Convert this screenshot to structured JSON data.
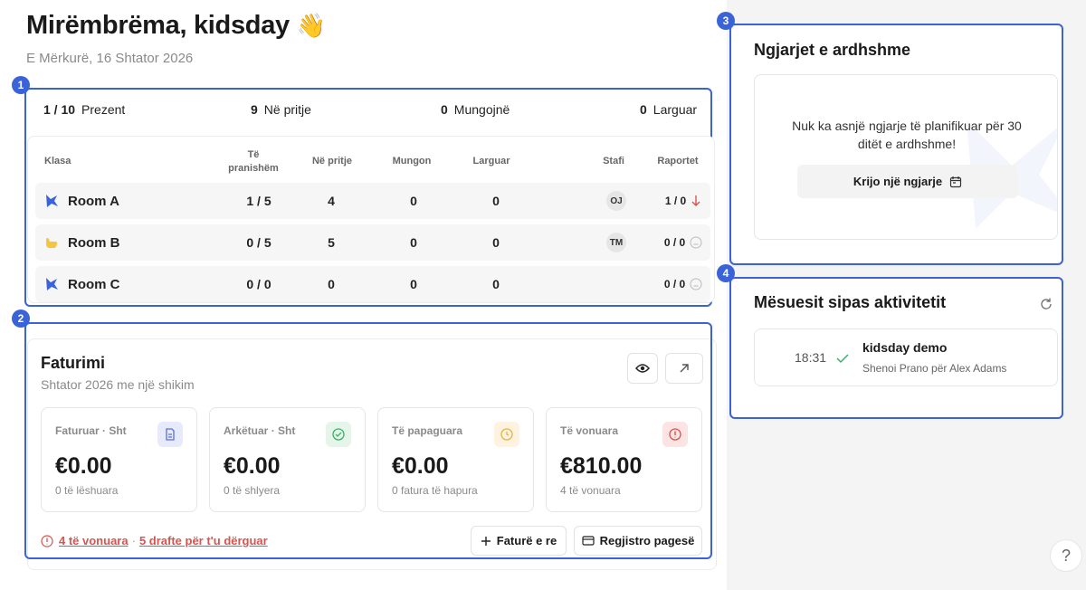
{
  "header": {
    "greeting": "Mirëmbrëma, kidsday",
    "wave_icon": "waving-hand",
    "date": "E Mërkurë, 16 Shtator 2026"
  },
  "annotations": [
    "1",
    "2",
    "3",
    "4"
  ],
  "attendance": {
    "stats": [
      {
        "value": "1 / 10",
        "label": "Prezent"
      },
      {
        "value": "9",
        "label": "Në pritje"
      },
      {
        "value": "0",
        "label": "Mungojnë"
      },
      {
        "value": "0",
        "label": "Larguar"
      }
    ],
    "columns": {
      "class": "Klasa",
      "present": "Të pranishëm",
      "pending": "Në pritje",
      "absent": "Mungon",
      "left": "Larguar",
      "staff": "Stafi",
      "reports": "Raportet"
    },
    "rows": [
      {
        "name": "Room A",
        "present": "1 / 5",
        "pending": "4",
        "absent": "0",
        "left": "0",
        "staff": "OJ",
        "reports": "1 / 0",
        "report_icon": "arrow-down",
        "icon_color": "#3b63d8"
      },
      {
        "name": "Room B",
        "present": "0 / 5",
        "pending": "5",
        "absent": "0",
        "left": "0",
        "staff": "TM",
        "reports": "0 / 0",
        "report_icon": "neutral-face",
        "icon_color": "#f5c542"
      },
      {
        "name": "Room C",
        "present": "0 / 0",
        "pending": "0",
        "absent": "0",
        "left": "0",
        "staff": "",
        "reports": "0 / 0",
        "report_icon": "neutral-face",
        "icon_color": "#3b63d8"
      }
    ]
  },
  "billing": {
    "title": "Faturimi",
    "subtitle": "Shtator 2026 me një shikim",
    "kpis": [
      {
        "label": "Faturuar · Sht",
        "value": "€0.00",
        "sub": "0 të lëshuara",
        "icon": "document-icon",
        "color": "#5b6fd6",
        "bg": "#e7eafb"
      },
      {
        "label": "Arkëtuar · Sht",
        "value": "€0.00",
        "sub": "0 të shlyera",
        "icon": "check-circle-icon",
        "color": "#3fae6a",
        "bg": "#e5f5ea"
      },
      {
        "label": "Të papaguara",
        "value": "€0.00",
        "sub": "0 fatura të hapura",
        "icon": "clock-icon",
        "color": "#e9b23f",
        "bg": "#fdf3e0"
      },
      {
        "label": "Të vonuara",
        "value": "€810.00",
        "sub": "4 të vonuara",
        "icon": "alert-icon",
        "color": "#d9534f",
        "bg": "#fbe4e3"
      }
    ],
    "overdue_link": "4 të vonuara",
    "drafts_link": "5 drafte për t'u dërguar",
    "separator": "·",
    "new_invoice": "Faturë e re",
    "register_payment": "Regjistro pagesë"
  },
  "events": {
    "title": "Ngjarjet e ardhshme",
    "empty": "Nuk ka asnjë ngjarje të planifikuar për 30 ditët e ardhshme!",
    "create": "Krijo një ngjarje"
  },
  "activity": {
    "title": "Mësuesit sipas aktivitetit",
    "items": [
      {
        "time": "18:31",
        "name": "kidsday demo",
        "detail": "Shenoi Prano për Alex Adams"
      }
    ]
  },
  "help": "?"
}
